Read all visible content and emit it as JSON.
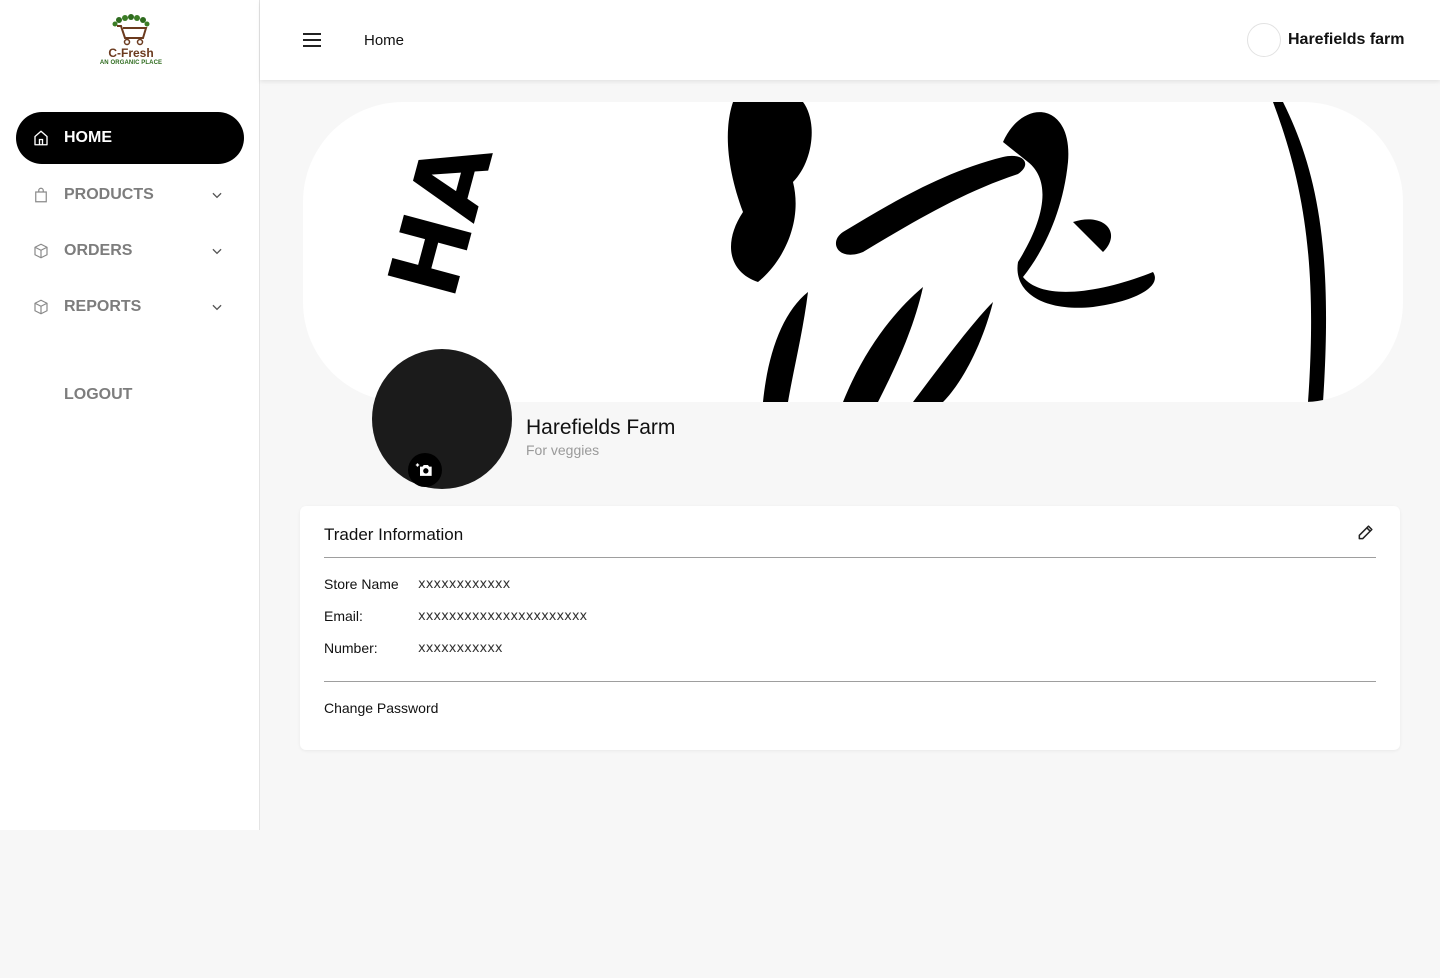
{
  "brand": {
    "name": "C-Fresh",
    "tagline": "AN ORGANIC PLACE"
  },
  "sidebar": {
    "items": [
      {
        "label": "HOME",
        "icon": "home-icon",
        "active": true
      },
      {
        "label": "PRODUCTS",
        "icon": "shopping-bag-icon",
        "expandable": true
      },
      {
        "label": "ORDERS",
        "icon": "box-icon",
        "expandable": true
      },
      {
        "label": "REPORTS",
        "icon": "box-icon",
        "expandable": true
      },
      {
        "label": "LOGOUT"
      }
    ]
  },
  "header": {
    "breadcrumb": "Home",
    "user_name": "Harefields farm"
  },
  "banner": {
    "logo_text": "HA"
  },
  "profile": {
    "store_title": "Harefields Farm",
    "subtitle": "For veggies"
  },
  "trader_info": {
    "title": "Trader Information",
    "fields": [
      {
        "label": "Store Name",
        "value": "xxxxxxxxxxxx"
      },
      {
        "label": "Email:",
        "value": "xxxxxxxxxxxxxxxxxxxxxx"
      },
      {
        "label": "Number:",
        "value": "xxxxxxxxxxx"
      }
    ],
    "change_password": "Change Password"
  },
  "colors": {
    "active_nav_bg": "#000000",
    "inactive_nav_text": "#7d7d7d",
    "page_bg": "#f7f7f7"
  }
}
